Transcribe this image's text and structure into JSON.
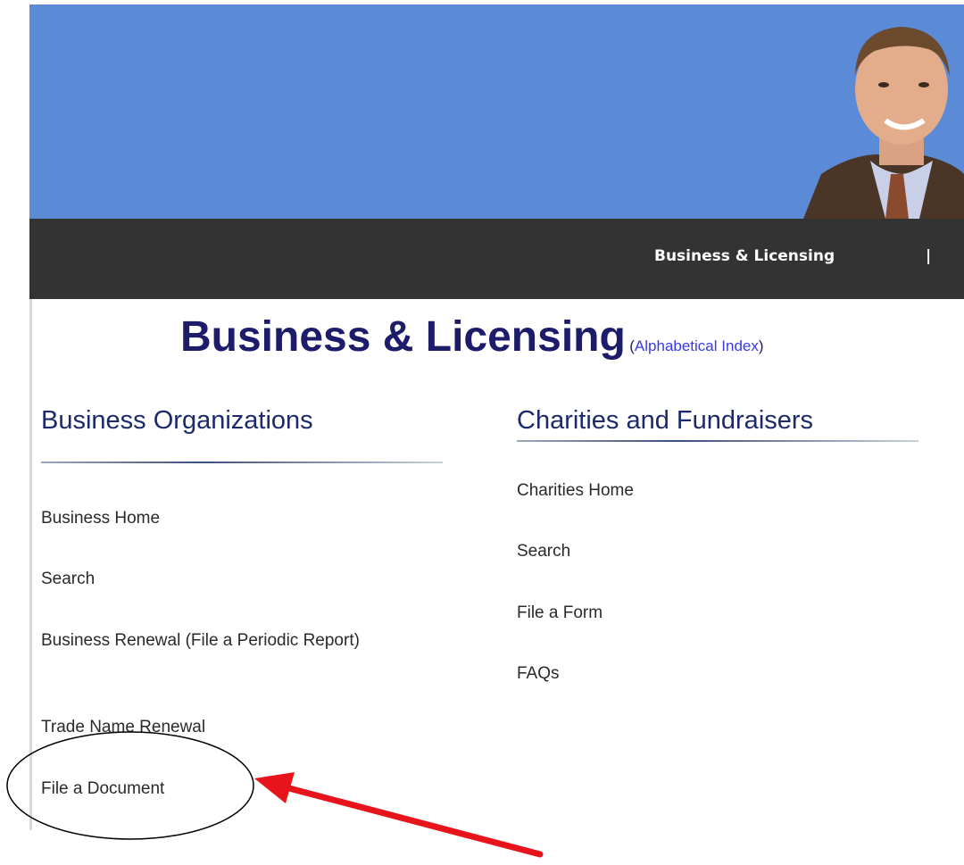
{
  "nav": {
    "business_licensing": "Business & Licensing",
    "separator": "|"
  },
  "page": {
    "title": "Business & Licensing",
    "index_open": "(",
    "index_link": "Alphabetical Index",
    "index_close": ")"
  },
  "business_orgs": {
    "heading": "Business Organizations",
    "links": [
      "Business Home",
      "Search",
      "Business Renewal (File a Periodic Report)",
      "Trade Name Renewal",
      "File a Document"
    ]
  },
  "charities": {
    "heading": "Charities and Fundraisers",
    "links": [
      "Charities Home",
      "Search",
      "File a Form",
      "FAQs"
    ]
  },
  "colors": {
    "banner": "#5b8bd6",
    "nav_bar": "#333333",
    "title": "#1c1c6b",
    "annotation_arrow": "#e8141b"
  }
}
